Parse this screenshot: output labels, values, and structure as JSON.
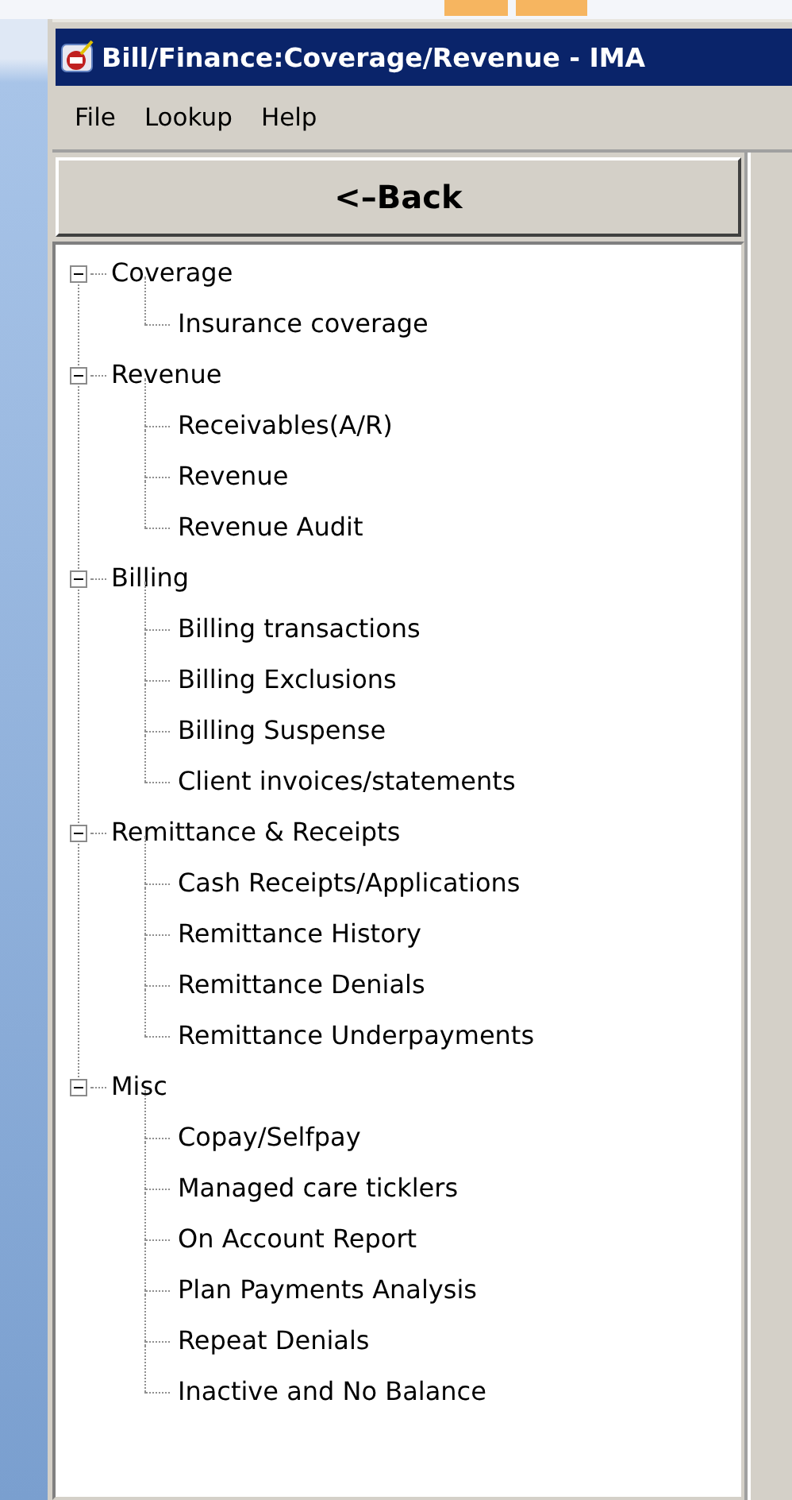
{
  "window": {
    "title": "Bill/Finance:Coverage/Revenue - IMA"
  },
  "menu": [
    "File",
    "Lookup",
    "Help"
  ],
  "back_button": {
    "label": "<–Back"
  },
  "tree": [
    {
      "label": "Coverage",
      "expanded": true,
      "children": [
        {
          "label": "Insurance coverage"
        }
      ]
    },
    {
      "label": "Revenue",
      "expanded": true,
      "children": [
        {
          "label": "Receivables(A/R)"
        },
        {
          "label": "Revenue"
        },
        {
          "label": "Revenue Audit"
        }
      ]
    },
    {
      "label": "Billing",
      "expanded": true,
      "children": [
        {
          "label": "Billing transactions"
        },
        {
          "label": "Billing Exclusions"
        },
        {
          "label": "Billing Suspense"
        },
        {
          "label": "Client invoices/statements"
        }
      ]
    },
    {
      "label": "Remittance & Receipts",
      "expanded": true,
      "children": [
        {
          "label": "Cash Receipts/Applications"
        },
        {
          "label": "Remittance History"
        },
        {
          "label": "Remittance Denials"
        },
        {
          "label": "Remittance Underpayments"
        }
      ]
    },
    {
      "label": "Misc",
      "expanded": true,
      "children": [
        {
          "label": "Copay/Selfpay"
        },
        {
          "label": "Managed care ticklers"
        },
        {
          "label": "On Account Report"
        },
        {
          "label": "Plan Payments Analysis"
        },
        {
          "label": "Repeat Denials"
        },
        {
          "label": "Inactive and No Balance"
        }
      ]
    }
  ]
}
